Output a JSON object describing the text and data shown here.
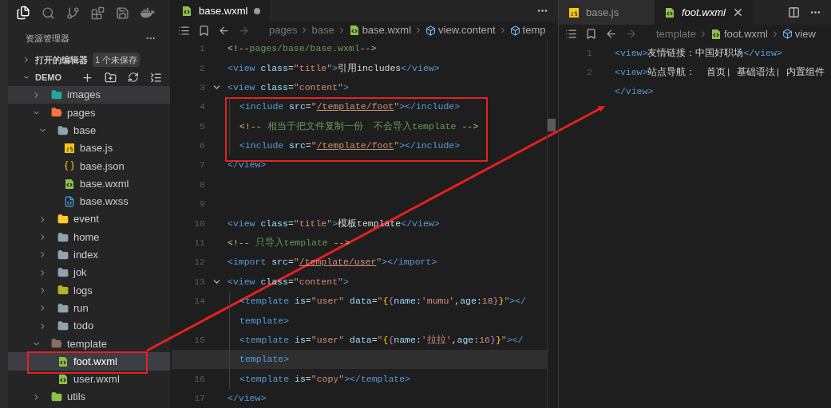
{
  "sidebar": {
    "title": "资源管理器",
    "more": "···",
    "open_editors": {
      "label": "打开的编辑器",
      "badge": "1 个未保存",
      "expanded": false
    },
    "workspace": {
      "label": "DEMO",
      "expanded": true
    },
    "tree": [
      {
        "name": "images",
        "kind": "images",
        "expanded": false,
        "selected": false,
        "hovered": true
      },
      {
        "name": "pages",
        "kind": "pages",
        "expanded": true,
        "selected": false,
        "hovered": false,
        "children": [
          {
            "name": "base",
            "kind": "folder",
            "expanded": true,
            "selected": false,
            "hovered": false,
            "children": [
              {
                "name": "base.js",
                "kind": "js",
                "selected": false,
                "hovered": false
              },
              {
                "name": "base.json",
                "kind": "json",
                "selected": false,
                "hovered": false
              },
              {
                "name": "base.wxml",
                "kind": "wxml",
                "selected": false,
                "hovered": false
              },
              {
                "name": "base.wxss",
                "kind": "wxss",
                "selected": false,
                "hovered": false
              }
            ]
          },
          {
            "name": "event",
            "kind": "event",
            "expanded": false,
            "selected": false,
            "hovered": false
          },
          {
            "name": "home",
            "kind": "folder",
            "expanded": false,
            "selected": false,
            "hovered": false
          },
          {
            "name": "index",
            "kind": "folder",
            "expanded": false,
            "selected": false,
            "hovered": false
          },
          {
            "name": "jok",
            "kind": "folder",
            "expanded": false,
            "selected": false,
            "hovered": false
          },
          {
            "name": "logs",
            "kind": "logs",
            "expanded": false,
            "selected": false,
            "hovered": false
          },
          {
            "name": "run",
            "kind": "folder",
            "expanded": false,
            "selected": false,
            "hovered": false
          },
          {
            "name": "todo",
            "kind": "folder",
            "expanded": false,
            "selected": false,
            "hovered": false
          }
        ]
      },
      {
        "name": "template",
        "kind": "template",
        "expanded": true,
        "selected": false,
        "hovered": false,
        "children": [
          {
            "name": "foot.wxml",
            "kind": "wxml",
            "selected": true,
            "hovered": false
          },
          {
            "name": "user.wxml",
            "kind": "wxml",
            "selected": false,
            "hovered": false
          }
        ]
      },
      {
        "name": "utils",
        "kind": "utils",
        "expanded": false,
        "selected": false,
        "hovered": false
      }
    ]
  },
  "editors": [
    {
      "tabs": [
        {
          "label": "base.wxml",
          "kind": "wxml",
          "selected": true,
          "modified": true,
          "preview": false
        }
      ],
      "breadcrumb": [
        {
          "label": "pages",
          "kind": "folder"
        },
        {
          "label": "base",
          "kind": "folder"
        },
        {
          "label": "base.wxml",
          "kind": "wxml"
        },
        {
          "label": "view.content",
          "kind": "element"
        },
        {
          "label": "temp",
          "kind": "element"
        }
      ],
      "lines": [
        {
          "number": "1",
          "indented": false,
          "foldable": false,
          "current": false,
          "tokens": [
            {
              "kind": "cmark",
              "text": "<!--"
            },
            {
              "kind": "comment",
              "text": "pages/base/base.wxml"
            },
            {
              "kind": "cmark",
              "text": "-->"
            }
          ]
        },
        {
          "number": "2",
          "indented": false,
          "foldable": false,
          "current": false,
          "tokens": [
            {
              "kind": "tag",
              "text": "<view"
            },
            {
              "kind": "attr",
              "text": " class"
            },
            {
              "kind": "op",
              "text": "="
            },
            {
              "kind": "str",
              "text": "\"title\""
            },
            {
              "kind": "tag",
              "text": ">"
            },
            {
              "kind": "text",
              "text": "引用includes"
            },
            {
              "kind": "tag",
              "text": "</view>"
            }
          ]
        },
        {
          "number": "3",
          "indented": false,
          "foldable": true,
          "current": false,
          "tokens": [
            {
              "kind": "tag",
              "text": "<view"
            },
            {
              "kind": "attr",
              "text": " class"
            },
            {
              "kind": "op",
              "text": "="
            },
            {
              "kind": "str",
              "text": "\"content\""
            },
            {
              "kind": "tag",
              "text": ">"
            }
          ]
        },
        {
          "number": "4",
          "indented": true,
          "foldable": false,
          "current": false,
          "tokens": [
            {
              "kind": "tag",
              "text": "<include"
            },
            {
              "kind": "attr",
              "text": " src"
            },
            {
              "kind": "op",
              "text": "="
            },
            {
              "kind": "str",
              "text": "\""
            },
            {
              "kind": "link",
              "text": "/template/foot"
            },
            {
              "kind": "str",
              "text": "\""
            },
            {
              "kind": "tag",
              "text": "></include>"
            }
          ]
        },
        {
          "number": "5",
          "indented": true,
          "foldable": false,
          "current": false,
          "tokens": [
            {
              "kind": "cmark",
              "text": "<!--"
            },
            {
              "kind": "comment",
              "text": " 相当于把文件复制一份  不会导入template "
            },
            {
              "kind": "cmark",
              "text": "-->"
            }
          ]
        },
        {
          "number": "6",
          "indented": true,
          "foldable": false,
          "current": false,
          "tokens": [
            {
              "kind": "tag",
              "text": "<include"
            },
            {
              "kind": "attr",
              "text": " src"
            },
            {
              "kind": "op",
              "text": "="
            },
            {
              "kind": "str",
              "text": "\""
            },
            {
              "kind": "link",
              "text": "/template/foot"
            },
            {
              "kind": "str",
              "text": "\""
            },
            {
              "kind": "tag",
              "text": "></include>"
            }
          ]
        },
        {
          "number": "7",
          "indented": false,
          "foldable": false,
          "current": false,
          "tokens": [
            {
              "kind": "tag",
              "text": "</view>"
            }
          ]
        },
        {
          "number": "8",
          "indented": false,
          "foldable": false,
          "current": false
        },
        {
          "number": "9",
          "indented": false,
          "foldable": false,
          "current": false
        },
        {
          "number": "10",
          "indented": false,
          "foldable": false,
          "current": false,
          "tokens": [
            {
              "kind": "tag",
              "text": "<view"
            },
            {
              "kind": "attr",
              "text": " class"
            },
            {
              "kind": "op",
              "text": "="
            },
            {
              "kind": "str",
              "text": "\"title\""
            },
            {
              "kind": "tag",
              "text": ">"
            },
            {
              "kind": "text",
              "text": "模板template"
            },
            {
              "kind": "tag",
              "text": "</view>"
            }
          ]
        },
        {
          "number": "11",
          "indented": false,
          "foldable": false,
          "current": false,
          "tokens": [
            {
              "kind": "cmark",
              "text": "<!--"
            },
            {
              "kind": "comment",
              "text": " 只导入template "
            },
            {
              "kind": "cmark",
              "text": "-->"
            }
          ]
        },
        {
          "number": "12",
          "indented": false,
          "foldable": false,
          "current": false,
          "tokens": [
            {
              "kind": "tag",
              "text": "<import"
            },
            {
              "kind": "attr",
              "text": " src"
            },
            {
              "kind": "op",
              "text": "="
            },
            {
              "kind": "str",
              "text": "\""
            },
            {
              "kind": "link",
              "text": "/template/user"
            },
            {
              "kind": "str",
              "text": "\""
            },
            {
              "kind": "tag",
              "text": "></import>"
            }
          ]
        },
        {
          "number": "13",
          "indented": false,
          "foldable": true,
          "current": false,
          "tokens": [
            {
              "kind": "tag",
              "text": "<view"
            },
            {
              "kind": "attr",
              "text": " class"
            },
            {
              "kind": "op",
              "text": "="
            },
            {
              "kind": "str",
              "text": "\"content\""
            },
            {
              "kind": "tag",
              "text": ">"
            }
          ]
        },
        {
          "number": "14",
          "indented": true,
          "foldable": false,
          "current": false,
          "tokens": [
            {
              "kind": "tag",
              "text": "<template"
            },
            {
              "kind": "attr",
              "text": " is"
            },
            {
              "kind": "op",
              "text": "="
            },
            {
              "kind": "str",
              "text": "\"user\""
            },
            {
              "kind": "attr",
              "text": " data"
            },
            {
              "kind": "op",
              "text": "="
            },
            {
              "kind": "str",
              "text": "\""
            },
            {
              "kind": "brace",
              "text": "{"
            },
            {
              "kind": "brace2",
              "text": "{"
            },
            {
              "kind": "attr",
              "text": "name"
            },
            {
              "kind": "op",
              "text": ":"
            },
            {
              "kind": "str",
              "text": "'mumu'"
            },
            {
              "kind": "op",
              "text": ","
            },
            {
              "kind": "attr",
              "text": "age"
            },
            {
              "kind": "op",
              "text": ":"
            },
            {
              "kind": "num",
              "text": "18"
            },
            {
              "kind": "brace2",
              "text": "}"
            },
            {
              "kind": "brace",
              "text": "}"
            },
            {
              "kind": "str",
              "text": "\""
            },
            {
              "kind": "tag",
              "text": "></"
            }
          ]
        },
        {
          "indented": true,
          "foldable": false,
          "current": false,
          "tokens": [
            {
              "kind": "tag",
              "text": "template>"
            }
          ]
        },
        {
          "number": "15",
          "indented": true,
          "foldable": false,
          "current": false,
          "tokens": [
            {
              "kind": "tag",
              "text": "<template"
            },
            {
              "kind": "attr",
              "text": " is"
            },
            {
              "kind": "op",
              "text": "="
            },
            {
              "kind": "str",
              "text": "\"user\""
            },
            {
              "kind": "attr",
              "text": " data"
            },
            {
              "kind": "op",
              "text": "="
            },
            {
              "kind": "str",
              "text": "\""
            },
            {
              "kind": "brace",
              "text": "{"
            },
            {
              "kind": "brace2",
              "text": "{"
            },
            {
              "kind": "attr",
              "text": "name"
            },
            {
              "kind": "op",
              "text": ":"
            },
            {
              "kind": "str",
              "text": "'拉拉'"
            },
            {
              "kind": "op",
              "text": ","
            },
            {
              "kind": "attr",
              "text": "age"
            },
            {
              "kind": "op",
              "text": ":"
            },
            {
              "kind": "num",
              "text": "16"
            },
            {
              "kind": "brace2",
              "text": "}"
            },
            {
              "kind": "brace",
              "text": "}"
            },
            {
              "kind": "str",
              "text": "\""
            },
            {
              "kind": "tag",
              "text": "></"
            }
          ]
        },
        {
          "indented": true,
          "foldable": false,
          "current": true,
          "tokens": [
            {
              "kind": "tag",
              "text": "template>"
            }
          ]
        },
        {
          "number": "16",
          "indented": true,
          "foldable": false,
          "current": false,
          "tokens": [
            {
              "kind": "tag",
              "text": "<template"
            },
            {
              "kind": "attr",
              "text": " is"
            },
            {
              "kind": "op",
              "text": "="
            },
            {
              "kind": "str",
              "text": "\"copy\""
            },
            {
              "kind": "tag",
              "text": "></template>"
            }
          ]
        },
        {
          "number": "17",
          "indented": false,
          "foldable": false,
          "current": false,
          "tokens": [
            {
              "kind": "tag",
              "text": "</view>"
            }
          ]
        }
      ]
    },
    {
      "tabs": [
        {
          "label": "base.js",
          "kind": "js",
          "selected": false,
          "modified": false,
          "preview": false
        },
        {
          "label": "foot.wxml",
          "kind": "wxml",
          "selected": true,
          "modified": false,
          "preview": true
        }
      ],
      "breadcrumb": [
        {
          "label": "template",
          "kind": "folder"
        },
        {
          "label": "foot.wxml",
          "kind": "wxml"
        },
        {
          "label": "view",
          "kind": "element"
        }
      ],
      "lines": [
        {
          "number": "1",
          "indented": false,
          "foldable": false,
          "current": false,
          "tokens": [
            {
              "kind": "tag",
              "text": "<view>"
            },
            {
              "kind": "text",
              "text": "友情链接：中国好职场"
            },
            {
              "kind": "tag",
              "text": "</view>"
            }
          ]
        },
        {
          "number": "2",
          "indented": false,
          "foldable": false,
          "current": false,
          "tokens": [
            {
              "kind": "tag",
              "text": "<view>"
            },
            {
              "kind": "text",
              "text": "站点导航：  首页| 基础语法| 内置组件"
            }
          ]
        },
        {
          "indented": false,
          "foldable": false,
          "current": false,
          "tokens": [
            {
              "kind": "tag",
              "text": "</view>"
            }
          ]
        }
      ]
    }
  ]
}
